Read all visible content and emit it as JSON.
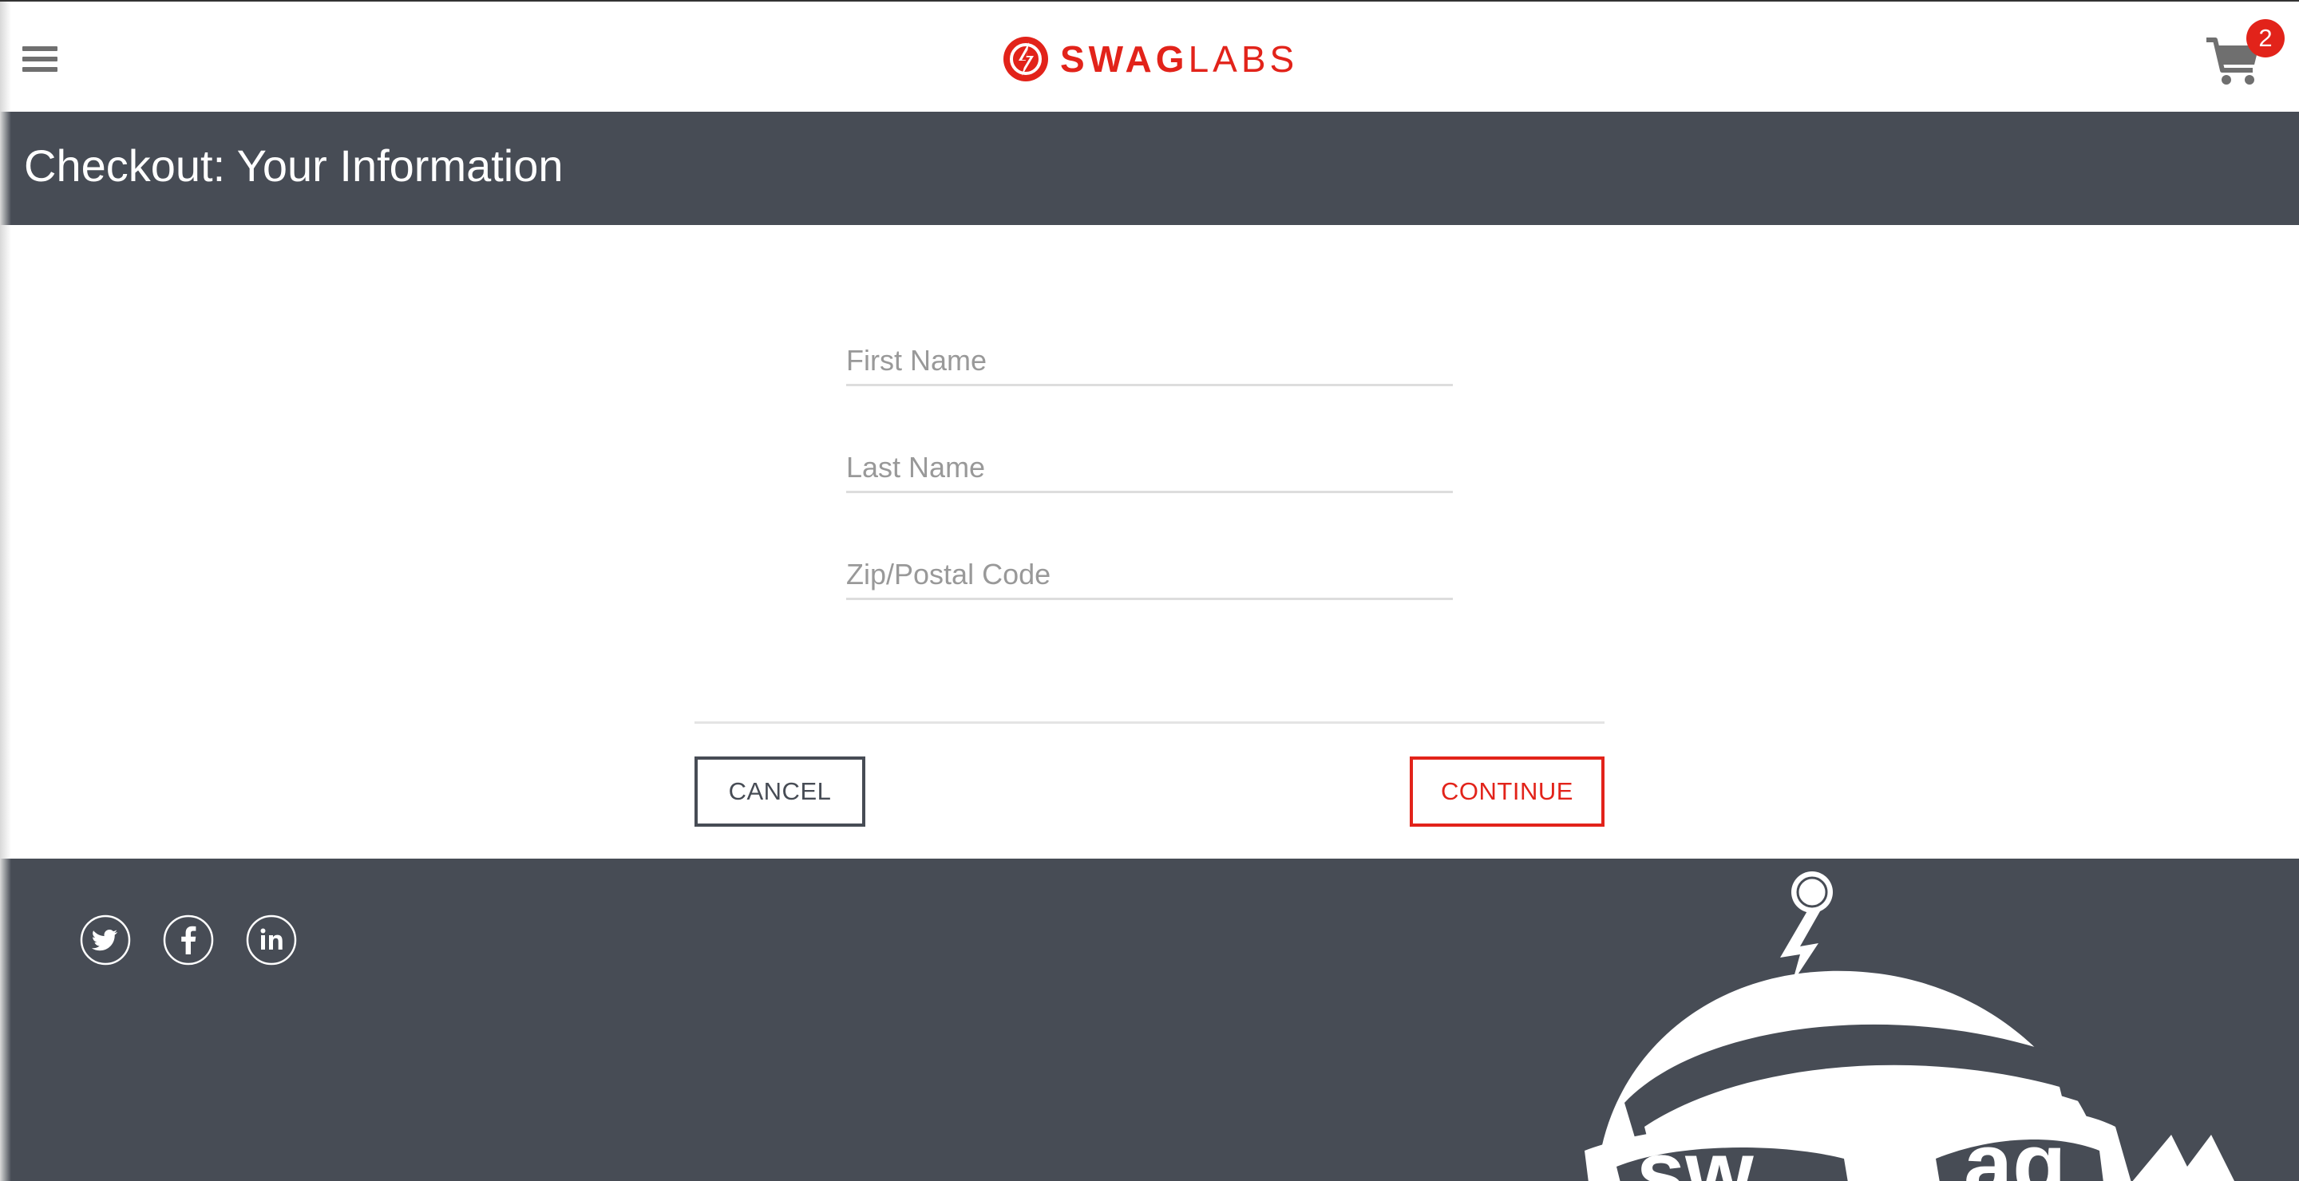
{
  "app": {
    "logo_bold": "SWAG",
    "logo_light": "LABS",
    "brand_color": "#e2231a"
  },
  "header": {
    "menu_icon": "hamburger-menu-icon",
    "cart_icon": "shopping-cart-icon",
    "cart_count": "2"
  },
  "page": {
    "title": "Checkout: Your Information",
    "title_bar_color": "#474c55"
  },
  "form": {
    "first_name": {
      "value": "",
      "placeholder": "First Name"
    },
    "last_name": {
      "value": "",
      "placeholder": "Last Name"
    },
    "postal_code": {
      "value": "",
      "placeholder": "Zip/Postal Code"
    }
  },
  "actions": {
    "cancel_label": "CANCEL",
    "continue_label": "CONTINUE"
  },
  "footer": {
    "background": "#474c55",
    "social": [
      "twitter-icon",
      "facebook-icon",
      "linkedin-icon"
    ],
    "mascot": "swag-bot-mascot"
  }
}
